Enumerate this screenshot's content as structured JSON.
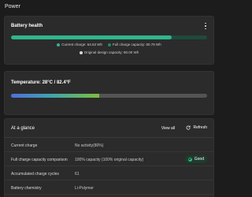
{
  "page": {
    "title": "Power"
  },
  "battery_health": {
    "title": "Battery health",
    "health_fraction": 0.82,
    "legend": {
      "current": "Current charge: 64.63 Wh",
      "full": "Full charge capacity: 80.78 Wh",
      "design": "Original design capacity: 80.00 Wh"
    },
    "colors": {
      "current": "#2fb58c",
      "full": "#1f8a63",
      "design": "#d8d8d8"
    }
  },
  "temperature": {
    "title": "Temperature:  28°C / 82.4°F",
    "fill_fraction": 0.45
  },
  "glance": {
    "title": "At a glance",
    "view_all": "View all",
    "refresh": "Refresh",
    "rows": [
      {
        "label": "Current charge",
        "value": "No activity(80%)"
      },
      {
        "label": "Full charge capacity comparison",
        "value": "100% capacity (100% original capacity)",
        "badge": "Good",
        "badge_icon": "check-circle-icon"
      },
      {
        "label": "Accumulated charge cycles",
        "value": "61"
      },
      {
        "label": "Battery chemistry",
        "value": "Li-Polymer"
      }
    ]
  }
}
